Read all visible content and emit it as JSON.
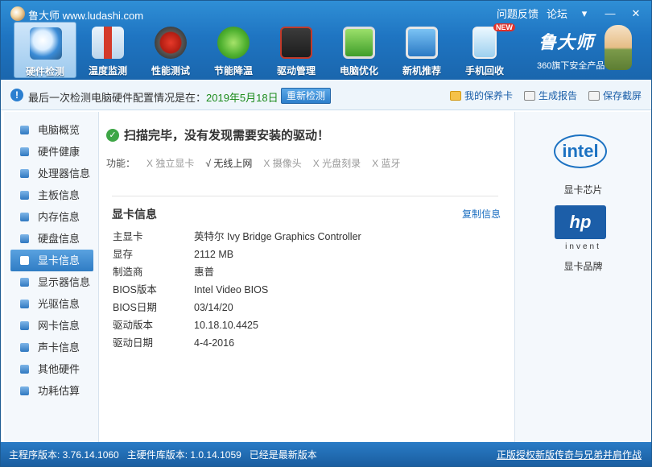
{
  "app": {
    "title": "鲁大师 www.ludashi.com"
  },
  "titlebar": {
    "feedback": "问题反馈",
    "forum": "论坛",
    "menu_glyph": "▾",
    "minimize_glyph": "—",
    "close_glyph": "✕"
  },
  "nav": [
    {
      "label": "硬件检测",
      "icon": "magnifier-icon",
      "active": true
    },
    {
      "label": "温度监测",
      "icon": "thermometer-icon"
    },
    {
      "label": "性能测试",
      "icon": "speedometer-icon"
    },
    {
      "label": "节能降温",
      "icon": "clover-icon"
    },
    {
      "label": "驱动管理",
      "icon": "driver-box-icon"
    },
    {
      "label": "电脑优化",
      "icon": "monitor-icon"
    },
    {
      "label": "新机推荐",
      "icon": "computer-award-icon"
    },
    {
      "label": "手机回收",
      "icon": "phone-recycle-icon",
      "badge": "NEW"
    }
  ],
  "brand": {
    "title": "鲁大师",
    "subtitle": "360旗下安全产品"
  },
  "infobar": {
    "message": "最后一次检测电脑硬件配置情况是在：",
    "date": "2019年5月18日",
    "recheck": "重新检测",
    "my_care": "我的保养卡",
    "report": "生成报告",
    "screenshot": "保存截屏"
  },
  "sidebar": [
    {
      "label": "电脑概览"
    },
    {
      "label": "硬件健康"
    },
    {
      "label": "处理器信息"
    },
    {
      "label": "主板信息"
    },
    {
      "label": "内存信息"
    },
    {
      "label": "硬盘信息"
    },
    {
      "label": "显卡信息",
      "active": true
    },
    {
      "label": "显示器信息"
    },
    {
      "label": "光驱信息"
    },
    {
      "label": "网卡信息"
    },
    {
      "label": "声卡信息"
    },
    {
      "label": "其他硬件"
    },
    {
      "label": "功耗估算"
    }
  ],
  "main": {
    "scan_result": "扫描完毕，没有发现需要安装的驱动！",
    "features_label": "功能：",
    "features": [
      {
        "mark": "X",
        "label": "独立显卡",
        "enabled": false
      },
      {
        "mark": "√",
        "label": "无线上网",
        "enabled": true
      },
      {
        "mark": "X",
        "label": "摄像头",
        "enabled": false
      },
      {
        "mark": "X",
        "label": "光盘刻录",
        "enabled": false
      },
      {
        "mark": "X",
        "label": "蓝牙",
        "enabled": false
      }
    ],
    "section_title": "显卡信息",
    "copy_info": "复制信息",
    "details": [
      {
        "key": "主显卡",
        "value": "英特尔 Ivy Bridge Graphics Controller"
      },
      {
        "key": "显存",
        "value": "2112 MB"
      },
      {
        "key": "制造商",
        "value": "惠普"
      },
      {
        "key": "BIOS版本",
        "value": "Intel Video BIOS"
      },
      {
        "key": "BIOS日期",
        "value": "03/14/20"
      },
      {
        "key": "驱动版本",
        "value": "10.18.10.4425"
      },
      {
        "key": "驱动日期",
        "value": "4-4-2016"
      }
    ]
  },
  "rightpanel": {
    "chip_logo_text": "intel",
    "chip_label": "显卡芯片",
    "brand_logo_text": "hp",
    "brand_logo_sub": "invent",
    "brand_label": "显卡品牌"
  },
  "status": {
    "text": "主程序版本: 3.76.14.1060   主硬件库版本: 1.0.14.1059   已经是最新版本",
    "link": "正版授权新版传奇与兄弟并肩作战"
  },
  "colors": {
    "accent": "#1f75c2",
    "date_green": "#1a8a1a",
    "link_blue": "#1a6ec0"
  }
}
